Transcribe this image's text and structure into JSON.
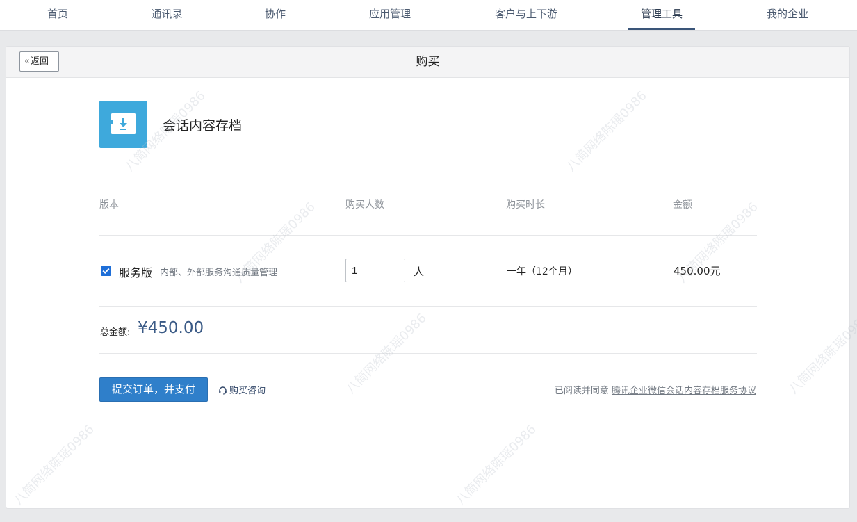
{
  "nav": {
    "items": [
      {
        "label": "首页",
        "active": false
      },
      {
        "label": "通讯录",
        "active": false
      },
      {
        "label": "协作",
        "active": false
      },
      {
        "label": "应用管理",
        "active": false
      },
      {
        "label": "客户与上下游",
        "active": false
      },
      {
        "label": "管理工具",
        "active": true
      },
      {
        "label": "我的企业",
        "active": false
      }
    ]
  },
  "header": {
    "back_label": "返回",
    "title": "购买"
  },
  "product": {
    "name": "会话内容存档",
    "icon": "download-box-icon",
    "icon_color": "#3ea9dc"
  },
  "table": {
    "headers": {
      "edition": "版本",
      "seats": "购买人数",
      "duration": "购买时长",
      "amount": "金额"
    },
    "row": {
      "checked": true,
      "edition_name": "服务版",
      "edition_desc": "内部、外部服务沟通质量管理",
      "seats_value": "1",
      "seats_unit": "人",
      "duration": "一年（12个月）",
      "amount": "450.00元"
    }
  },
  "total": {
    "label": "总金额:",
    "value": "¥450.00"
  },
  "actions": {
    "submit_label": "提交订单，并支付",
    "consult_label": "购买咨询",
    "agree_prefix": "已阅读并同意",
    "agree_link": "腾讯企业微信会话内容存档服务协议"
  },
  "watermark": {
    "text": "八简网络陈瑶0986"
  },
  "colors": {
    "accent": "#2f7fca",
    "total_value": "#3a5a86",
    "nav_active_underline": "#3a5579"
  }
}
